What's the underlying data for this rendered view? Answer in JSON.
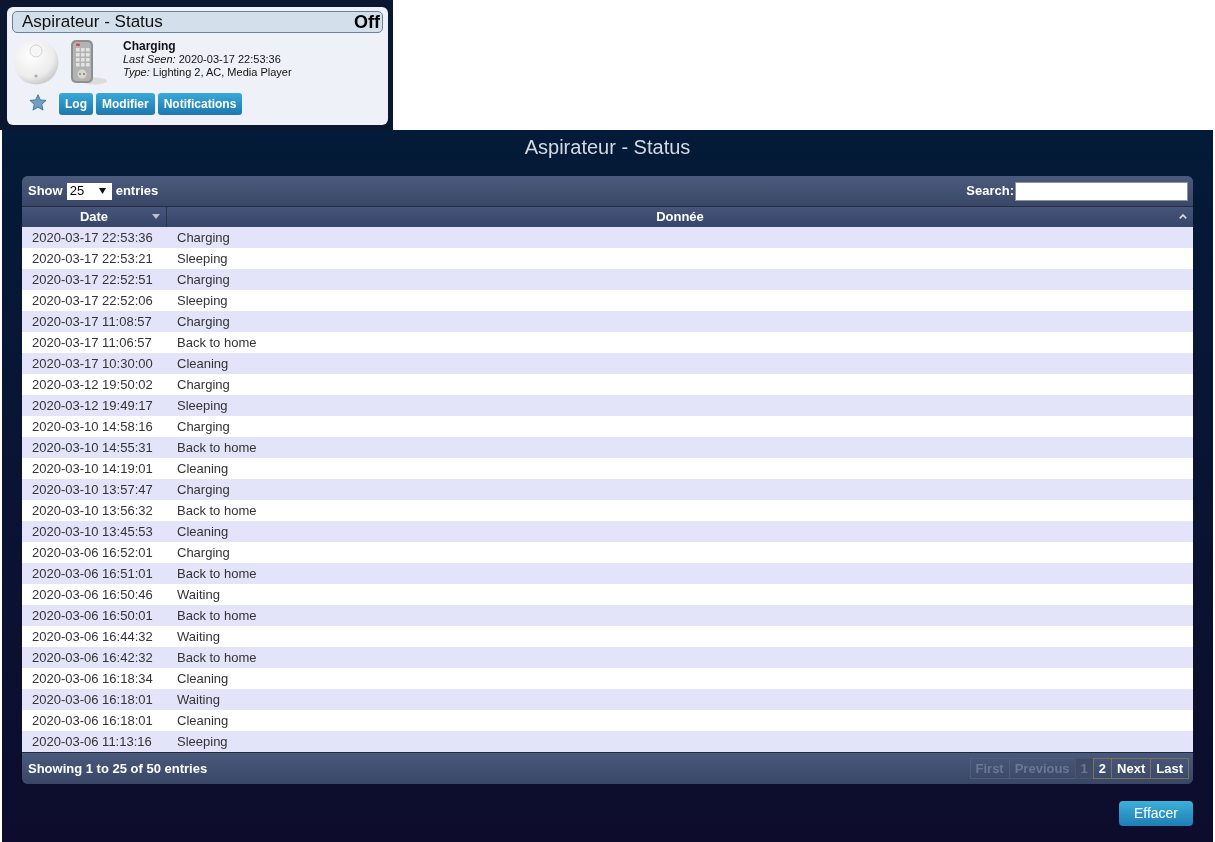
{
  "device_card": {
    "title": "Aspirateur - Status",
    "state": "Off",
    "status": "Charging",
    "last_seen": "*Last Seen:* 2020-03-17 22:53:36",
    "type": "*Type:* Lighting 2, AC, Media Player",
    "favorite": false,
    "buttons": [
      "Log",
      "Modifier",
      "Notifications"
    ]
  },
  "page_title": "Aspirateur - Status",
  "table": {
    "length_label": "Show",
    "page_length": "25",
    "length_suffix": "entries",
    "search_label": "Search:",
    "columns": [
      {
        "label": "Date",
        "sorted": true
      },
      {
        "label": "Donnée",
        "sorted": false
      }
    ],
    "rows": [
      {
        "date": "2020-03-17 22:53:36",
        "value": "Charging"
      },
      {
        "date": "2020-03-17 22:53:21",
        "value": "Sleeping"
      },
      {
        "date": "2020-03-17 22:52:51",
        "value": "Charging"
      },
      {
        "date": "2020-03-17 22:52:06",
        "value": "Sleeping"
      },
      {
        "date": "2020-03-17 11:08:57",
        "value": "Charging"
      },
      {
        "date": "2020-03-17 11:06:57",
        "value": "Back to home"
      },
      {
        "date": "2020-03-17 10:30:00",
        "value": "Cleaning"
      },
      {
        "date": "2020-03-12 19:50:02",
        "value": "Charging"
      },
      {
        "date": "2020-03-12 19:49:17",
        "value": "Sleeping"
      },
      {
        "date": "2020-03-10 14:58:16",
        "value": "Charging"
      },
      {
        "date": "2020-03-10 14:55:31",
        "value": "Back to home"
      },
      {
        "date": "2020-03-10 14:19:01",
        "value": "Cleaning"
      },
      {
        "date": "2020-03-10 13:57:47",
        "value": "Charging"
      },
      {
        "date": "2020-03-10 13:56:32",
        "value": "Back to home"
      },
      {
        "date": "2020-03-10 13:45:53",
        "value": "Cleaning"
      },
      {
        "date": "2020-03-06 16:52:01",
        "value": "Charging"
      },
      {
        "date": "2020-03-06 16:51:01",
        "value": "Back to home"
      },
      {
        "date": "2020-03-06 16:50:46",
        "value": "Waiting"
      },
      {
        "date": "2020-03-06 16:50:01",
        "value": "Back to home"
      },
      {
        "date": "2020-03-06 16:44:32",
        "value": "Waiting"
      },
      {
        "date": "2020-03-06 16:42:32",
        "value": "Back to home"
      },
      {
        "date": "2020-03-06 16:18:34",
        "value": "Cleaning"
      },
      {
        "date": "2020-03-06 16:18:01",
        "value": "Waiting"
      },
      {
        "date": "2020-03-06 16:18:01",
        "value": "Cleaning"
      },
      {
        "date": "2020-03-06 11:13:16",
        "value": "Sleeping"
      }
    ],
    "info": "Showing 1 to 25 of 50 entries",
    "pager": [
      {
        "kind": "nav",
        "label": "First",
        "disabled": true
      },
      {
        "kind": "nav",
        "label": "Previous",
        "disabled": true
      },
      {
        "kind": "page",
        "label": "1",
        "selected": true
      },
      {
        "kind": "page",
        "label": "2",
        "selected": false
      },
      {
        "kind": "nav",
        "label": "Next",
        "disabled": false
      },
      {
        "kind": "nav",
        "label": "Last",
        "disabled": false
      }
    ]
  },
  "clear_button": "Effacer"
}
